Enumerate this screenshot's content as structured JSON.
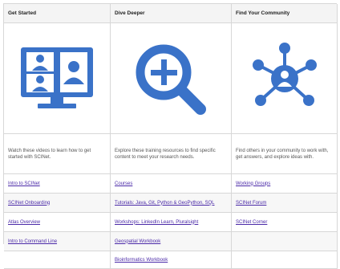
{
  "columns": [
    {
      "header": "Get Started",
      "icon": "video-conference-icon",
      "description": "Watch these videos to learn how to get started with SCINet.",
      "links": [
        "Intro to SCINet",
        "SCINet Onboarding",
        "Atlas Overview",
        "Intro to Command Line",
        ""
      ]
    },
    {
      "header": "Dive Deeper",
      "icon": "magnifier-plus-icon",
      "description": "Explore these training resources to find specific content to meet your research needs.",
      "links": [
        "Courses",
        "Tutorials: Java, Git, Python & GeoPython, SQL",
        "Workshops: LinkedIn Learn, Pluralsight",
        "Geospatial Workbook",
        "Bioinformatics Workbook"
      ]
    },
    {
      "header": "Find Your Community",
      "icon": "community-network-icon",
      "description": "Find others in your community to work with, get answers, and explore ideas with.",
      "links": [
        "Working Groups",
        "SCINet Forum",
        "SCINet Corner",
        "",
        ""
      ]
    }
  ],
  "colors": {
    "icon_blue": "#3a72c8",
    "link_purple": "#4b2aa8",
    "border": "#d7d7d7"
  }
}
